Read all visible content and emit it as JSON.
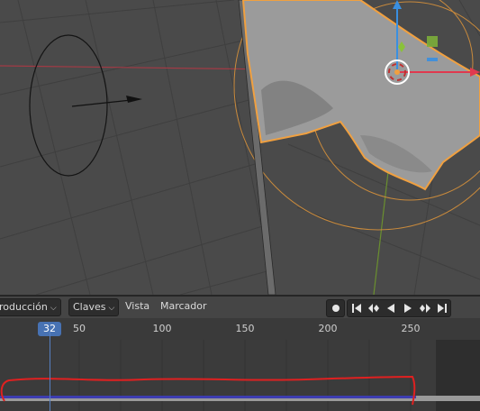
{
  "timeline": {
    "mode_menu_label": "roducción",
    "view_dropdown_label": "Claves",
    "view_menu": "Vista",
    "marker_menu": "Marcador",
    "current_frame": "32",
    "ticks": [
      "50",
      "100",
      "150",
      "200",
      "250"
    ]
  },
  "viewport": {
    "gizmo_colors": {
      "x_axis": "#e0394f",
      "y_axis": "#8ac23a",
      "z_axis": "#3a8fe0",
      "selection_outline": "#f0a040"
    }
  },
  "transport_buttons": [
    "record-icon",
    "jump-to-start-icon",
    "jump-to-keyframe-prev-icon",
    "play-reverse-icon",
    "play-icon",
    "jump-to-keyframe-next-icon",
    "jump-to-end-icon"
  ],
  "annotation": {
    "color": "#e02020"
  }
}
